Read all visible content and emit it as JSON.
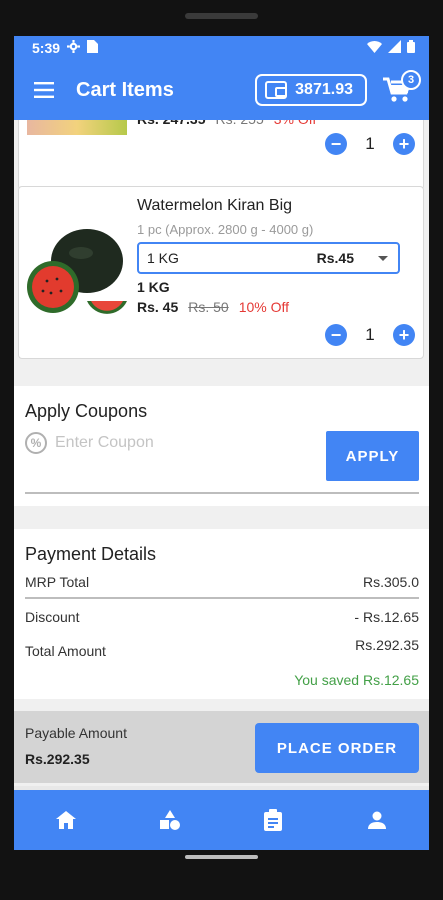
{
  "status_bar": {
    "time": "5:39"
  },
  "app_bar": {
    "title": "Cart Items",
    "wallet_balance": "3871.93",
    "cart_count": "3"
  },
  "cart_items": [
    {
      "price_now": "Rs. 247.35",
      "price_old": "Rs. 255",
      "discount": "3% Off",
      "quantity": "1"
    },
    {
      "name": "Watermelon Kiran Big",
      "description": "1 pc (Approx. 2800 g - 4000 g)",
      "variant_label": "1 KG",
      "variant_price": "Rs.45",
      "unit": "1 KG",
      "price_now": "Rs. 45",
      "price_old": "Rs. 50",
      "discount": "10% Off",
      "quantity": "1"
    }
  ],
  "coupons": {
    "title": "Apply Coupons",
    "placeholder": "Enter Coupon",
    "apply_label": "APPLY"
  },
  "payment": {
    "title": "Payment Details",
    "mrp_label": "MRP Total",
    "mrp_value": "Rs.305.0",
    "discount_label": "Discount",
    "discount_value": "- Rs.12.65",
    "total_label": "Total Amount",
    "total_value": "Rs.292.35",
    "saved_text": "You saved Rs.12.65"
  },
  "payable": {
    "label": "Payable Amount",
    "value": "Rs.292.35",
    "order_label": "PLACE ORDER"
  },
  "bottom_nav": [
    "home-icon",
    "categories-icon",
    "orders-icon",
    "account-icon"
  ],
  "colors": {
    "primary": "#4285f4",
    "discount_red": "#e53935",
    "saved_green": "#43a047"
  }
}
